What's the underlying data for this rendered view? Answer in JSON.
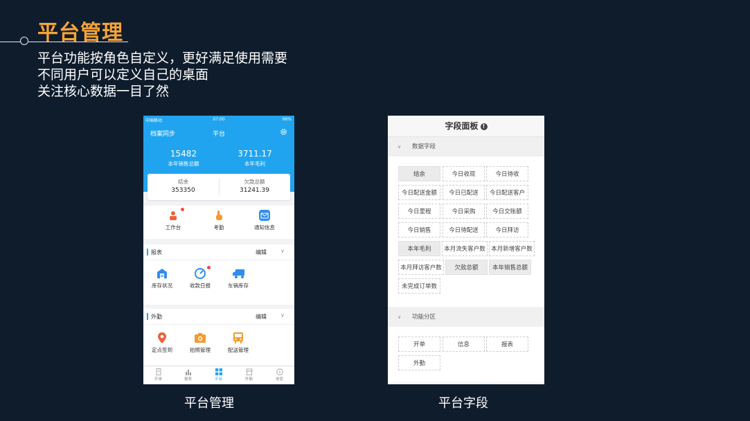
{
  "slide": {
    "title": "平台管理",
    "lines": [
      "平台功能按角色自定义，更好满足使用需要",
      "不同用户可以定义自己的桌面",
      "关注核心数据一目了然"
    ],
    "captions": {
      "left": "平台管理",
      "right": "平台字段"
    }
  },
  "phone": {
    "status": {
      "carrier": "中国移动",
      "time": "07:00",
      "battery": "96%"
    },
    "nav": {
      "left": "档案同步",
      "title": "平台",
      "settings_icon": "gear-icon"
    },
    "stats": [
      {
        "value": "15482",
        "label": "本年销售总额"
      },
      {
        "value": "3711.17",
        "label": "本年毛利"
      }
    ],
    "card": [
      {
        "label": "结余",
        "value": "353350"
      },
      {
        "label": "欠款总额",
        "value": "31241.39"
      }
    ],
    "quick": [
      {
        "label": "工作台",
        "icon": "worker-icon"
      },
      {
        "label": "考勤",
        "icon": "hand-icon"
      },
      {
        "label": "通知信息",
        "icon": "mail-icon"
      }
    ],
    "sections": [
      {
        "title": "报表",
        "edit": "编辑",
        "items": [
          {
            "label": "库存状况",
            "icon": "warehouse-icon"
          },
          {
            "label": "收款日报",
            "icon": "dial-icon"
          },
          {
            "label": "车销库存",
            "icon": "truck-icon"
          }
        ]
      },
      {
        "title": "外勤",
        "edit": "编辑",
        "items": [
          {
            "label": "定点签到",
            "icon": "location-pin-icon"
          },
          {
            "label": "拍照管理",
            "icon": "camera-icon"
          },
          {
            "label": "配送管理",
            "icon": "bus-icon"
          }
        ]
      }
    ],
    "tabs": [
      "开单",
      "报表",
      "平台",
      "外勤",
      "信息"
    ]
  },
  "panel": {
    "title": "字段面板",
    "groups": [
      {
        "title": "数据字段",
        "chips": [
          "结余",
          "今日收现",
          "今日待收",
          "今日配送金额",
          "今日已配送",
          "今日配送客户",
          "今日里程",
          "今日采购",
          "今日交账额",
          "今日销售",
          "今日待配送",
          "今日拜访",
          "本年毛利",
          "本月流失客户数",
          "本月新增客户数",
          "本月拜访客户数",
          "欠款总额",
          "本年销售总额",
          "未完成订单数"
        ]
      },
      {
        "title": "功能分区",
        "chips": [
          "开单",
          "信息",
          "报表",
          "外勤"
        ]
      }
    ]
  },
  "colors": {
    "background": "#0f1c2c",
    "accent": "#f5a43a",
    "phone_blue": "#21a4ef"
  }
}
